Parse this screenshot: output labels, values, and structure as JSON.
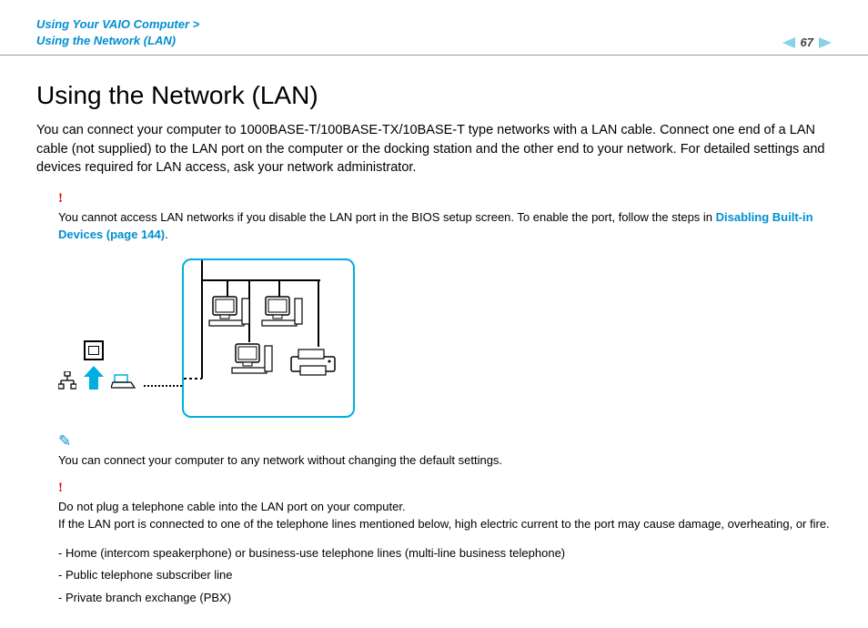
{
  "header": {
    "breadcrumb_line1": "Using Your VAIO Computer >",
    "breadcrumb_line2": "Using the Network (LAN)",
    "page_number": "67"
  },
  "main": {
    "title": "Using the Network (LAN)",
    "intro": "You can connect your computer to 1000BASE-T/100BASE-TX/10BASE-T type networks with a LAN cable. Connect one end of a LAN cable (not supplied) to the LAN port on the computer or the docking station and the other end to your network. For detailed settings and devices required for LAN access, ask your network administrator.",
    "warning1_text": "You cannot access LAN networks if you disable the LAN port in the BIOS setup screen. To enable the port, follow the steps in ",
    "warning1_link": "Disabling Built-in Devices (page 144)",
    "warning1_suffix": ".",
    "tip_text": "You can connect your computer to any network without changing the default settings.",
    "warning2_line1": "Do not plug a telephone cable into the LAN port on your computer.",
    "warning2_line2": "If the LAN port is connected to one of the telephone lines mentioned below, high electric current to the port may cause damage, overheating, or fire.",
    "list": [
      "Home (intercom speakerphone) or business-use telephone lines (multi-line business telephone)",
      "Public telephone subscriber line",
      "Private branch exchange (PBX)"
    ]
  }
}
